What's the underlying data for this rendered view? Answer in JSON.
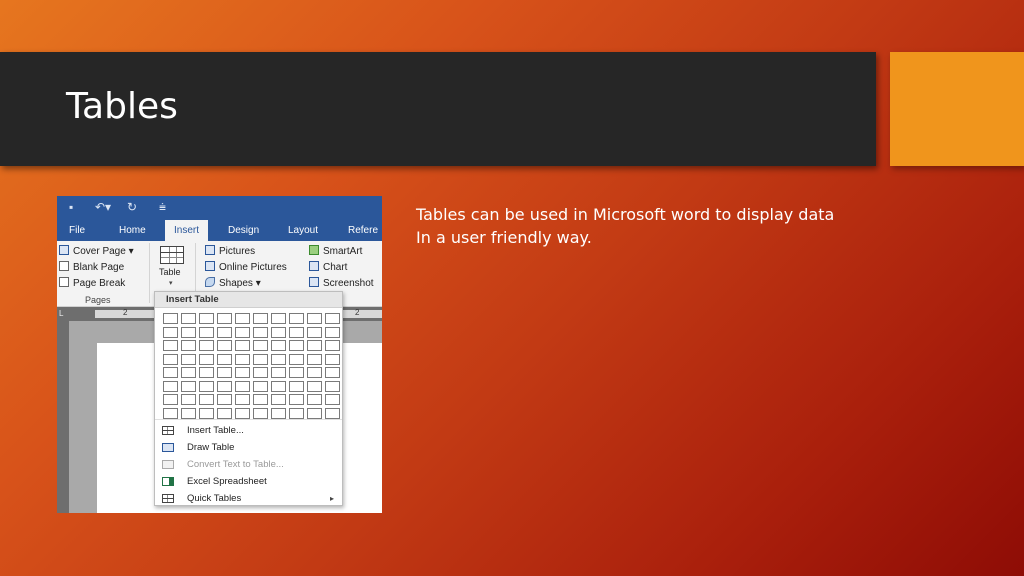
{
  "slide": {
    "title": "Tables",
    "body_lines": [
      "Tables can be used in Microsoft word to display data",
      "In a user friendly way."
    ],
    "colors": {
      "title_bar": "#262626",
      "accent": "#f0951c",
      "background_start": "#e6761f",
      "background_end": "#8e0c05"
    }
  },
  "word": {
    "qat": {
      "save_icon": "save-icon",
      "undo_icon": "undo-icon",
      "redo_icon": "redo-icon",
      "customize_icon": "customize-icon"
    },
    "tabs": [
      "File",
      "Home",
      "Insert",
      "Design",
      "Layout",
      "Refere"
    ],
    "active_tab": "Insert",
    "ribbon": {
      "pages": [
        "Cover Page ▾",
        "Blank Page",
        "Page Break"
      ],
      "pages_label": "Pages",
      "table_label": "Table",
      "illustrations": [
        "Pictures",
        "Online Pictures",
        "Shapes ▾"
      ],
      "illustrations2": [
        "SmartArt",
        "Chart",
        "Screenshot"
      ]
    },
    "ruler": {
      "marks_left": "2",
      "marks_right": "2",
      "corner": "L"
    },
    "dropdown": {
      "header": "Insert Table",
      "grid": {
        "columns": 10,
        "rows": 8
      },
      "items": [
        {
          "label": "Insert Table...",
          "icon": "insert-table-icon",
          "enabled": true
        },
        {
          "label": "Draw Table",
          "icon": "draw-table-icon",
          "enabled": true
        },
        {
          "label": "Convert Text to Table...",
          "icon": "convert-text-icon",
          "enabled": false
        },
        {
          "label": "Excel Spreadsheet",
          "icon": "excel-icon",
          "enabled": true
        },
        {
          "label": "Quick Tables",
          "icon": "quick-tables-icon",
          "enabled": true,
          "submenu": true
        }
      ]
    }
  }
}
